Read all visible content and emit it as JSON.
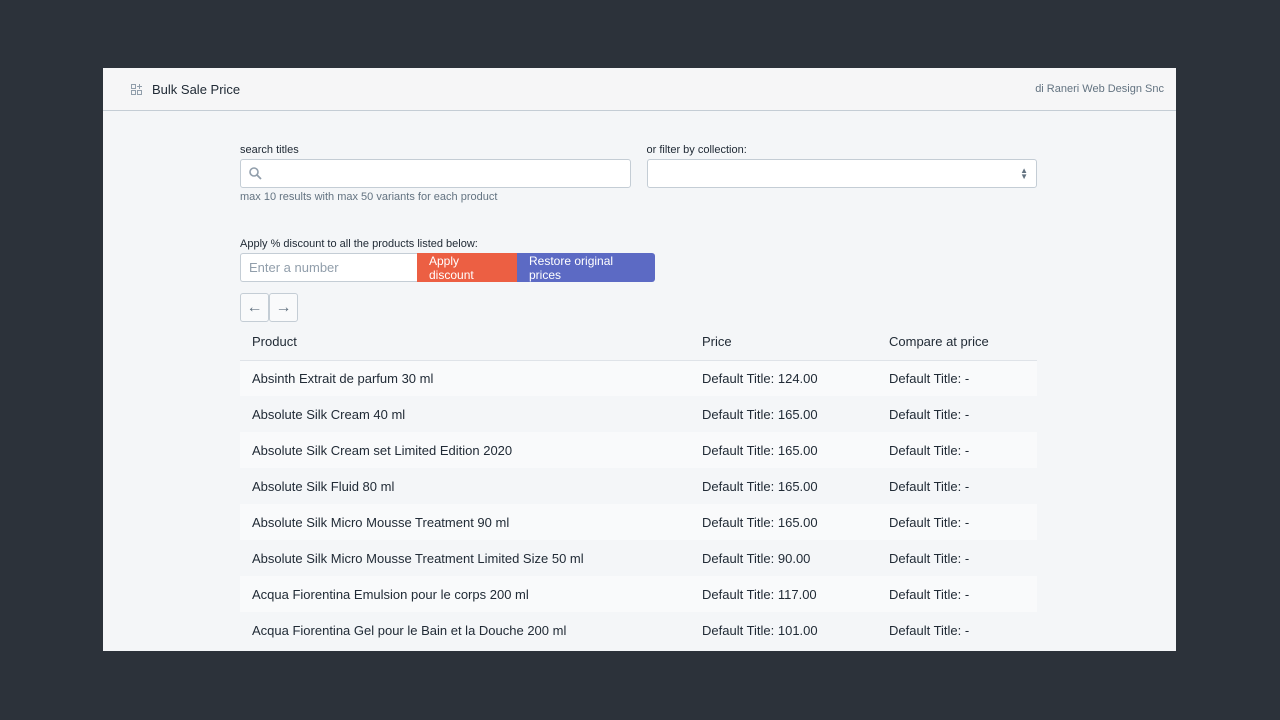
{
  "header": {
    "title": "Bulk Sale Price",
    "vendor": "di Raneri Web Design Snc",
    "icon": "apps-icon"
  },
  "search": {
    "label": "search titles",
    "placeholder": "",
    "help": "max 10 results with max 50 variants for each product"
  },
  "collection": {
    "label": "or filter by collection:",
    "value": ""
  },
  "discount": {
    "label": "Apply % discount to all the products listed below:",
    "placeholder": "Enter a number",
    "apply_label": "Apply discount",
    "restore_label": "Restore original prices",
    "apply_color": "#ec5f43",
    "restore_color": "#5c6ac4"
  },
  "table": {
    "headers": [
      "Product",
      "Price",
      "Compare at price"
    ],
    "rows": [
      [
        "Absinth Extrait de parfum 30 ml",
        "Default Title: 124.00",
        "Default Title: -"
      ],
      [
        "Absolute Silk Cream 40 ml",
        "Default Title: 165.00",
        "Default Title: -"
      ],
      [
        "Absolute Silk Cream set Limited Edition 2020",
        "Default Title: 165.00",
        "Default Title: -"
      ],
      [
        "Absolute Silk Fluid 80 ml",
        "Default Title: 165.00",
        "Default Title: -"
      ],
      [
        "Absolute Silk Micro Mousse Treatment 90 ml",
        "Default Title: 165.00",
        "Default Title: -"
      ],
      [
        "Absolute Silk Micro Mousse Treatment Limited Size 50 ml",
        "Default Title: 90.00",
        "Default Title: -"
      ],
      [
        "Acqua Fiorentina Emulsion pour le corps 200 ml",
        "Default Title: 117.00",
        "Default Title: -"
      ],
      [
        "Acqua Fiorentina Gel pour le Bain et la Douche 200 ml",
        "Default Title: 101.00",
        "Default Title: -"
      ]
    ]
  }
}
